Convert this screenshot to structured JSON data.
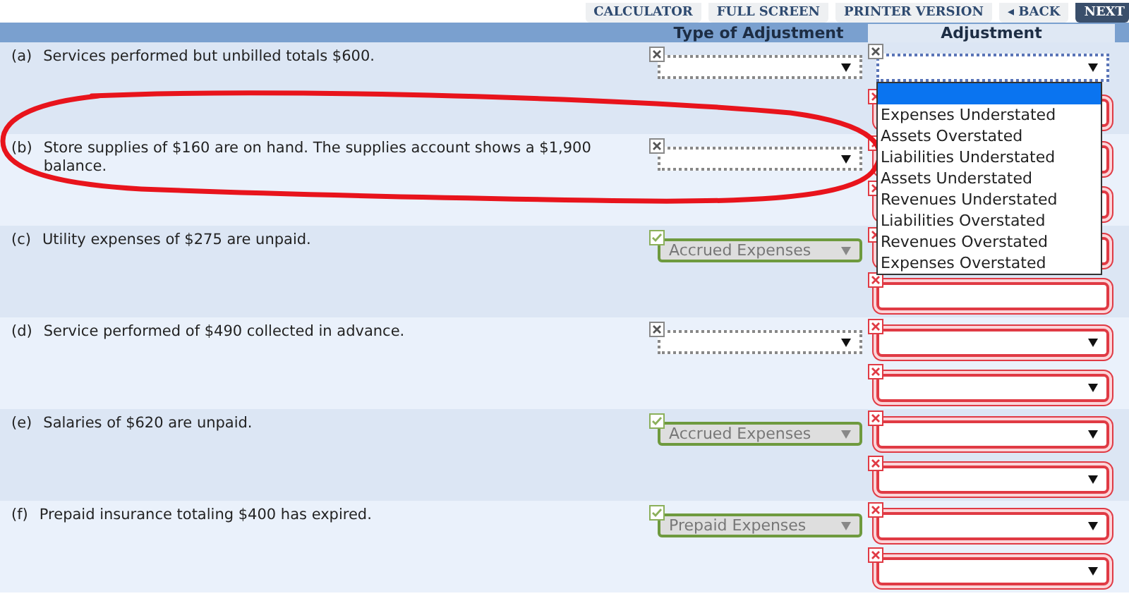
{
  "toolbar": {
    "buttons": [
      {
        "label": "CALCULATOR",
        "kind": "plain"
      },
      {
        "label": "FULL SCREEN",
        "kind": "plain"
      },
      {
        "label": "PRINTER VERSION",
        "kind": "plain"
      },
      {
        "label": "◂ BACK",
        "kind": "plain"
      },
      {
        "label": "NEXT",
        "kind": "primary"
      }
    ]
  },
  "table": {
    "columns": [
      "Type of Adjustment",
      "Adjustment"
    ],
    "rows": [
      {
        "letter": "(a)",
        "text": "Services performed but unbilled totals $600.",
        "type": {
          "kind": "unanswered"
        },
        "adjustments": [
          {
            "kind": "unanswered",
            "expanded": true
          },
          {
            "kind": "incorrect",
            "expanded": false
          }
        ]
      },
      {
        "letter": "(b)",
        "text": "Store supplies of $160 are on hand. The supplies account shows a $1,900 balance.",
        "type": {
          "kind": "unanswered"
        },
        "adjustments": [
          {
            "kind": "incorrect",
            "expanded": false
          },
          {
            "kind": "incorrect",
            "expanded": false
          }
        ]
      },
      {
        "letter": "(c)",
        "text": "Utility expenses of $275 are unpaid.",
        "type": {
          "value": "Accrued Expenses",
          "kind": "correct"
        },
        "adjustments": [
          {
            "kind": "incorrect",
            "expanded": false
          },
          {
            "kind": "incorrect",
            "expanded": false
          }
        ]
      },
      {
        "letter": "(d)",
        "text": "Service performed of $490 collected in advance.",
        "type": {
          "kind": "unanswered"
        },
        "adjustments": [
          {
            "kind": "incorrect",
            "expanded": false
          },
          {
            "kind": "incorrect",
            "expanded": false
          }
        ]
      },
      {
        "letter": "(e)",
        "text": "Salaries of $620 are unpaid.",
        "type": {
          "value": "Accrued Expenses",
          "kind": "correct"
        },
        "adjustments": [
          {
            "kind": "incorrect",
            "expanded": false
          },
          {
            "kind": "incorrect",
            "expanded": false
          }
        ]
      },
      {
        "letter": "(f)",
        "text": "Prepaid insurance totaling $400 has expired.",
        "type": {
          "value": "Prepaid Expenses",
          "kind": "correct"
        },
        "adjustments": [
          {
            "kind": "incorrect",
            "expanded": false
          },
          {
            "kind": "incorrect",
            "expanded": false
          }
        ]
      }
    ]
  },
  "dropdown": {
    "options": [
      {
        "selected": true
      },
      {
        "label": "Expenses Understated",
        "selected": false
      },
      {
        "label": "Assets Overstated",
        "selected": false
      },
      {
        "label": "Liabilities Understated",
        "selected": false
      },
      {
        "label": "Assets Understated",
        "selected": false
      },
      {
        "label": "Revenues Understated",
        "selected": false
      },
      {
        "label": "Liabilities Overstated",
        "selected": false
      },
      {
        "label": "Revenues Overstated",
        "selected": false
      },
      {
        "label": "Expenses Overstated",
        "selected": false
      }
    ]
  }
}
